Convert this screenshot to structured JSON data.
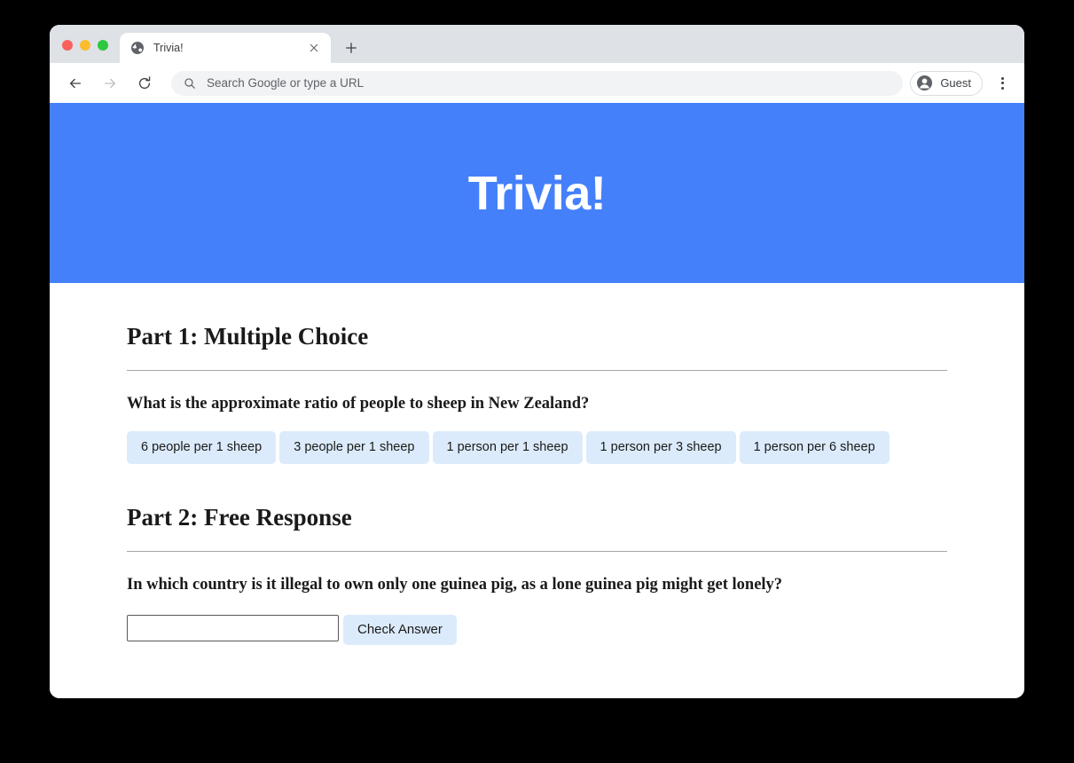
{
  "browser": {
    "traffic_lights": [
      "close",
      "minimize",
      "maximize"
    ],
    "tab": {
      "title": "Trivia!",
      "favicon": "globe-icon",
      "close_label": "×"
    },
    "new_tab_label": "+",
    "nav": {
      "back": "back-arrow-icon",
      "forward": "forward-arrow-icon",
      "reload": "reload-icon"
    },
    "omnibox": {
      "value": "",
      "placeholder": "Search Google or type a URL",
      "icon": "search-icon"
    },
    "profile": {
      "name": "Guest",
      "avatar": "person-icon"
    },
    "menu": "three-dot-menu-icon"
  },
  "page": {
    "hero": {
      "title": "Trivia!",
      "background_color": "#4580fb",
      "text_color": "#ffffff"
    },
    "part1": {
      "heading": "Part 1: Multiple Choice",
      "question": "What is the approximate ratio of people to sheep in New Zealand?",
      "choices": [
        "6 people per 1 sheep",
        "3 people per 1 sheep",
        "1 person per 1 sheep",
        "1 person per 3 sheep",
        "1 person per 6 sheep"
      ]
    },
    "part2": {
      "heading": "Part 2: Free Response",
      "question": "In which country is it illegal to own only one guinea pig, as a lone guinea pig might get lonely?",
      "input_value": "",
      "input_placeholder": "",
      "submit_label": "Check Answer"
    },
    "colors": {
      "button_background": "#dcebfb",
      "rule": "#a6a6a6",
      "text": "#1a1a1a"
    }
  }
}
